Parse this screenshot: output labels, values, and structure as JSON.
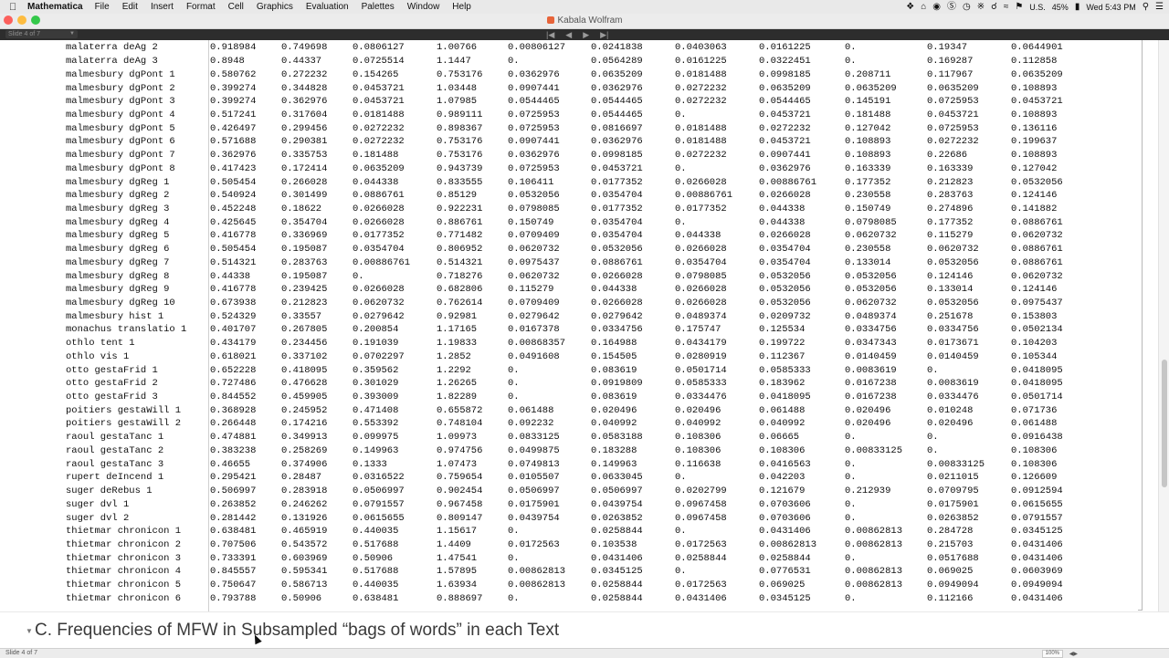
{
  "menubar": {
    "app": "Mathematica",
    "menus": [
      "File",
      "Edit",
      "Insert",
      "Format",
      "Cell",
      "Graphics",
      "Evaluation",
      "Palettes",
      "Window",
      "Help"
    ],
    "locale": "U.S.",
    "battery": "45%",
    "clock": "Wed 5:43 PM"
  },
  "window": {
    "title": "Kabala Wolfram",
    "slide_indicator": "Slide 4 of 7",
    "nav": [
      "|◀",
      "◀",
      "▶",
      "▶|"
    ]
  },
  "table": {
    "rows": [
      [
        "malaterra deAg 2",
        "0.918984",
        "0.749698",
        "0.0806127",
        "1.00766",
        "0.00806127",
        "0.0241838",
        "0.0403063",
        "0.0161225",
        "0.",
        "0.19347",
        "0.0644901"
      ],
      [
        "malaterra deAg 3",
        "0.8948",
        "0.44337",
        "0.0725514",
        "1.1447",
        "0.",
        "0.0564289",
        "0.0161225",
        "0.0322451",
        "0.",
        "0.169287",
        "0.112858"
      ],
      [
        "malmesbury dgPont 1",
        "0.580762",
        "0.272232",
        "0.154265",
        "0.753176",
        "0.0362976",
        "0.0635209",
        "0.0181488",
        "0.0998185",
        "0.208711",
        "0.117967",
        "0.0635209"
      ],
      [
        "malmesbury dgPont 2",
        "0.399274",
        "0.344828",
        "0.0453721",
        "1.03448",
        "0.0907441",
        "0.0362976",
        "0.0272232",
        "0.0635209",
        "0.0635209",
        "0.0635209",
        "0.108893"
      ],
      [
        "malmesbury dgPont 3",
        "0.399274",
        "0.362976",
        "0.0453721",
        "1.07985",
        "0.0544465",
        "0.0544465",
        "0.0272232",
        "0.0544465",
        "0.145191",
        "0.0725953",
        "0.0453721"
      ],
      [
        "malmesbury dgPont 4",
        "0.517241",
        "0.317604",
        "0.0181488",
        "0.989111",
        "0.0725953",
        "0.0544465",
        "0.",
        "0.0453721",
        "0.181488",
        "0.0453721",
        "0.108893"
      ],
      [
        "malmesbury dgPont 5",
        "0.426497",
        "0.299456",
        "0.0272232",
        "0.898367",
        "0.0725953",
        "0.0816697",
        "0.0181488",
        "0.0272232",
        "0.127042",
        "0.0725953",
        "0.136116"
      ],
      [
        "malmesbury dgPont 6",
        "0.571688",
        "0.290381",
        "0.0272232",
        "0.753176",
        "0.0907441",
        "0.0362976",
        "0.0181488",
        "0.0453721",
        "0.108893",
        "0.0272232",
        "0.199637"
      ],
      [
        "malmesbury dgPont 7",
        "0.362976",
        "0.335753",
        "0.181488",
        "0.753176",
        "0.0362976",
        "0.0998185",
        "0.0272232",
        "0.0907441",
        "0.108893",
        "0.22686",
        "0.108893"
      ],
      [
        "malmesbury dgPont 8",
        "0.417423",
        "0.172414",
        "0.0635209",
        "0.943739",
        "0.0725953",
        "0.0453721",
        "0.",
        "0.0362976",
        "0.163339",
        "0.163339",
        "0.127042"
      ],
      [
        "malmesbury dgReg 1",
        "0.505454",
        "0.266028",
        "0.044338",
        "0.833555",
        "0.106411",
        "0.0177352",
        "0.0266028",
        "0.00886761",
        "0.177352",
        "0.212823",
        "0.0532056"
      ],
      [
        "malmesbury dgReg 2",
        "0.540924",
        "0.301499",
        "0.0886761",
        "0.85129",
        "0.0532056",
        "0.0354704",
        "0.00886761",
        "0.0266028",
        "0.230558",
        "0.283763",
        "0.124146"
      ],
      [
        "malmesbury dgReg 3",
        "0.452248",
        "0.18622",
        "0.0266028",
        "0.922231",
        "0.0798085",
        "0.0177352",
        "0.0177352",
        "0.044338",
        "0.150749",
        "0.274896",
        "0.141882"
      ],
      [
        "malmesbury dgReg 4",
        "0.425645",
        "0.354704",
        "0.0266028",
        "0.886761",
        "0.150749",
        "0.0354704",
        "0.",
        "0.044338",
        "0.0798085",
        "0.177352",
        "0.0886761"
      ],
      [
        "malmesbury dgReg 5",
        "0.416778",
        "0.336969",
        "0.0177352",
        "0.771482",
        "0.0709409",
        "0.0354704",
        "0.044338",
        "0.0266028",
        "0.0620732",
        "0.115279",
        "0.0620732"
      ],
      [
        "malmesbury dgReg 6",
        "0.505454",
        "0.195087",
        "0.0354704",
        "0.806952",
        "0.0620732",
        "0.0532056",
        "0.0266028",
        "0.0354704",
        "0.230558",
        "0.0620732",
        "0.0886761"
      ],
      [
        "malmesbury dgReg 7",
        "0.514321",
        "0.283763",
        "0.00886761",
        "0.514321",
        "0.0975437",
        "0.0886761",
        "0.0354704",
        "0.0354704",
        "0.133014",
        "0.0532056",
        "0.0886761"
      ],
      [
        "malmesbury dgReg 8",
        "0.44338",
        "0.195087",
        "0.",
        "0.718276",
        "0.0620732",
        "0.0266028",
        "0.0798085",
        "0.0532056",
        "0.0532056",
        "0.124146",
        "0.0620732"
      ],
      [
        "malmesbury dgReg 9",
        "0.416778",
        "0.239425",
        "0.0266028",
        "0.682806",
        "0.115279",
        "0.044338",
        "0.0266028",
        "0.0532056",
        "0.0532056",
        "0.133014",
        "0.124146"
      ],
      [
        "malmesbury dgReg 10",
        "0.673938",
        "0.212823",
        "0.0620732",
        "0.762614",
        "0.0709409",
        "0.0266028",
        "0.0266028",
        "0.0532056",
        "0.0620732",
        "0.0532056",
        "0.0975437"
      ],
      [
        "malmesbury hist 1",
        "0.524329",
        "0.33557",
        "0.0279642",
        "0.92981",
        "0.0279642",
        "0.0279642",
        "0.0489374",
        "0.0209732",
        "0.0489374",
        "0.251678",
        "0.153803"
      ],
      [
        "monachus translatio 1",
        "0.401707",
        "0.267805",
        "0.200854",
        "1.17165",
        "0.0167378",
        "0.0334756",
        "0.175747",
        "0.125534",
        "0.0334756",
        "0.0334756",
        "0.0502134"
      ],
      [
        "othlo tent 1",
        "0.434179",
        "0.234456",
        "0.191039",
        "1.19833",
        "0.00868357",
        "0.164988",
        "0.0434179",
        "0.199722",
        "0.0347343",
        "0.0173671",
        "0.104203"
      ],
      [
        "othlo vis 1",
        "0.618021",
        "0.337102",
        "0.0702297",
        "1.2852",
        "0.0491608",
        "0.154505",
        "0.0280919",
        "0.112367",
        "0.0140459",
        "0.0140459",
        "0.105344"
      ],
      [
        "otto gestaFrid 1",
        "0.652228",
        "0.418095",
        "0.359562",
        "1.2292",
        "0.",
        "0.083619",
        "0.0501714",
        "0.0585333",
        "0.0083619",
        "0.",
        "0.0418095"
      ],
      [
        "otto gestaFrid 2",
        "0.727486",
        "0.476628",
        "0.301029",
        "1.26265",
        "0.",
        "0.0919809",
        "0.0585333",
        "0.183962",
        "0.0167238",
        "0.0083619",
        "0.0418095"
      ],
      [
        "otto gestaFrid 3",
        "0.844552",
        "0.459905",
        "0.393009",
        "1.82289",
        "0.",
        "0.083619",
        "0.0334476",
        "0.0418095",
        "0.0167238",
        "0.0334476",
        "0.0501714"
      ],
      [
        "poitiers gestaWill 1",
        "0.368928",
        "0.245952",
        "0.471408",
        "0.655872",
        "0.061488",
        "0.020496",
        "0.020496",
        "0.061488",
        "0.020496",
        "0.010248",
        "0.071736"
      ],
      [
        "poitiers gestaWill 2",
        "0.266448",
        "0.174216",
        "0.553392",
        "0.748104",
        "0.092232",
        "0.040992",
        "0.040992",
        "0.040992",
        "0.020496",
        "0.020496",
        "0.061488"
      ],
      [
        "raoul gestaTanc 1",
        "0.474881",
        "0.349913",
        "0.099975",
        "1.09973",
        "0.0833125",
        "0.0583188",
        "0.108306",
        "0.06665",
        "0.",
        "0.",
        "0.0916438"
      ],
      [
        "raoul gestaTanc 2",
        "0.383238",
        "0.258269",
        "0.149963",
        "0.974756",
        "0.0499875",
        "0.183288",
        "0.108306",
        "0.108306",
        "0.00833125",
        "0.",
        "0.108306"
      ],
      [
        "raoul gestaTanc 3",
        "0.46655",
        "0.374906",
        "0.1333",
        "1.07473",
        "0.0749813",
        "0.149963",
        "0.116638",
        "0.0416563",
        "0.",
        "0.00833125",
        "0.108306"
      ],
      [
        "rupert deIncend 1",
        "0.295421",
        "0.28487",
        "0.0316522",
        "0.759654",
        "0.0105507",
        "0.0633045",
        "0.",
        "0.042203",
        "0.",
        "0.0211015",
        "0.126609"
      ],
      [
        "suger deRebus 1",
        "0.506997",
        "0.283918",
        "0.0506997",
        "0.902454",
        "0.0506997",
        "0.0506997",
        "0.0202799",
        "0.121679",
        "0.212939",
        "0.0709795",
        "0.0912594"
      ],
      [
        "suger dvl 1",
        "0.263852",
        "0.246262",
        "0.0791557",
        "0.967458",
        "0.0175901",
        "0.0439754",
        "0.0967458",
        "0.0703606",
        "0.",
        "0.0175901",
        "0.0615655"
      ],
      [
        "suger dvl 2",
        "0.281442",
        "0.131926",
        "0.0615655",
        "0.809147",
        "0.0439754",
        "0.0263852",
        "0.0967458",
        "0.0703606",
        "0.",
        "0.0263852",
        "0.0791557"
      ],
      [
        "thietmar chronicon 1",
        "0.638481",
        "0.465919",
        "0.440035",
        "1.15617",
        "0.",
        "0.0258844",
        "0.",
        "0.0431406",
        "0.00862813",
        "0.284728",
        "0.0345125"
      ],
      [
        "thietmar chronicon 2",
        "0.707506",
        "0.543572",
        "0.517688",
        "1.4409",
        "0.0172563",
        "0.103538",
        "0.0172563",
        "0.00862813",
        "0.00862813",
        "0.215703",
        "0.0431406"
      ],
      [
        "thietmar chronicon 3",
        "0.733391",
        "0.603969",
        "0.50906",
        "1.47541",
        "0.",
        "0.0431406",
        "0.0258844",
        "0.0258844",
        "0.",
        "0.0517688",
        "0.0431406"
      ],
      [
        "thietmar chronicon 4",
        "0.845557",
        "0.595341",
        "0.517688",
        "1.57895",
        "0.00862813",
        "0.0345125",
        "0.",
        "0.0776531",
        "0.00862813",
        "0.069025",
        "0.0603969"
      ],
      [
        "thietmar chronicon 5",
        "0.750647",
        "0.586713",
        "0.440035",
        "1.63934",
        "0.00862813",
        "0.0258844",
        "0.0172563",
        "0.069025",
        "0.00862813",
        "0.0949094",
        "0.0949094"
      ],
      [
        "thietmar chronicon 6",
        "0.793788",
        "0.50906",
        "0.638481",
        "0.888697",
        "0.",
        "0.0258844",
        "0.0431406",
        "0.0345125",
        "0.",
        "0.112166",
        "0.0431406"
      ]
    ]
  },
  "section": {
    "heading": "C. Frequencies of MFW in Subsampled “bags of words” in each Text"
  },
  "statusbar": {
    "slide": "Slide 4 of 7",
    "zoom": "100%"
  },
  "colors": {
    "close": "#fc605c",
    "minimize": "#fdbc40",
    "zoom": "#34c84a",
    "slidebar": "#2d2d2d"
  }
}
